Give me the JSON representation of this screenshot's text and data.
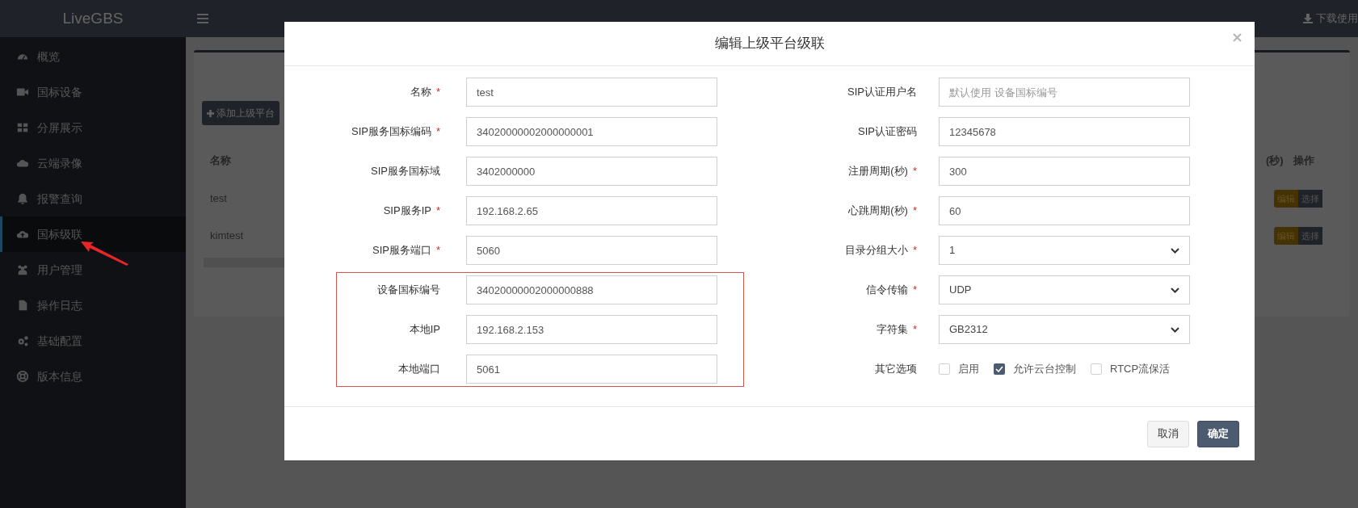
{
  "brand": {
    "logo": "LiveGBS"
  },
  "header": {
    "download_link": "下载使用"
  },
  "sidebar": {
    "items": [
      {
        "label": "概览",
        "selected": false
      },
      {
        "label": "国标设备",
        "selected": false
      },
      {
        "label": "分屏展示",
        "selected": false
      },
      {
        "label": "云端录像",
        "selected": false
      },
      {
        "label": "报警查询",
        "selected": false
      },
      {
        "label": "国标级联",
        "selected": true
      },
      {
        "label": "用户管理",
        "selected": false
      },
      {
        "label": "操作日志",
        "selected": false
      },
      {
        "label": "基础配置",
        "selected": false
      },
      {
        "label": "版本信息",
        "selected": false
      }
    ]
  },
  "background_page": {
    "add_button": "添加上级平台",
    "table": {
      "columns": [
        "名称",
        "(秒)",
        "操作"
      ],
      "rows": [
        {
          "name": "test",
          "actions": [
            "编辑",
            "选择"
          ]
        },
        {
          "name": "kimtest",
          "actions": [
            "编辑",
            "选择"
          ]
        }
      ]
    }
  },
  "dialog": {
    "title": "编辑上级平台级联",
    "left_fields": [
      {
        "label": "名称",
        "required_mark": "*",
        "kind": "text",
        "value": "test",
        "highlighted": false
      },
      {
        "label": "SIP服务国标编码",
        "required_mark": "*",
        "kind": "text",
        "value": "34020000002000000001",
        "highlighted": false
      },
      {
        "label": "SIP服务国标域",
        "kind": "text",
        "value": "3402000000",
        "highlighted": false
      },
      {
        "label": "SIP服务IP",
        "required_mark": "*",
        "kind": "text",
        "value": "192.168.2.65",
        "highlighted": false
      },
      {
        "label": "SIP服务端口",
        "required_mark": "*",
        "kind": "text",
        "value": "5060",
        "highlighted": false
      },
      {
        "label": "设备国标编号",
        "kind": "text",
        "value": "34020000002000000888",
        "highlighted": true
      },
      {
        "label": "本地IP",
        "kind": "text",
        "value": "192.168.2.153",
        "highlighted": true
      },
      {
        "label": "本地端口",
        "kind": "text",
        "value": "5061",
        "highlighted": true
      }
    ],
    "right_fields": [
      {
        "label": "SIP认证用户名",
        "kind": "text",
        "placeholder": "默认使用 设备国标编号"
      },
      {
        "label": "SIP认证密码",
        "kind": "text",
        "value": "12345678"
      },
      {
        "label": "注册周期(秒)",
        "required_mark": "*",
        "kind": "text",
        "value": "300"
      },
      {
        "label": "心跳周期(秒)",
        "required_mark": "*",
        "kind": "text",
        "value": "60"
      },
      {
        "label": "目录分组大小",
        "required_mark": "*",
        "kind": "select",
        "value": "1"
      },
      {
        "label": "信令传输",
        "required_mark": "*",
        "kind": "select",
        "value": "UDP"
      },
      {
        "label": "字符集",
        "required_mark": "*",
        "kind": "select",
        "value": "GB2312"
      }
    ],
    "other_options": {
      "label": "其它选项",
      "options": [
        {
          "label": "启用",
          "checked": false
        },
        {
          "label": "允许云台控制",
          "checked": true
        },
        {
          "label": "RTCP流保活",
          "checked": false
        }
      ]
    },
    "buttons": [
      {
        "label": "取消",
        "kind": "default"
      },
      {
        "label": "确定",
        "kind": "primary"
      }
    ]
  }
}
